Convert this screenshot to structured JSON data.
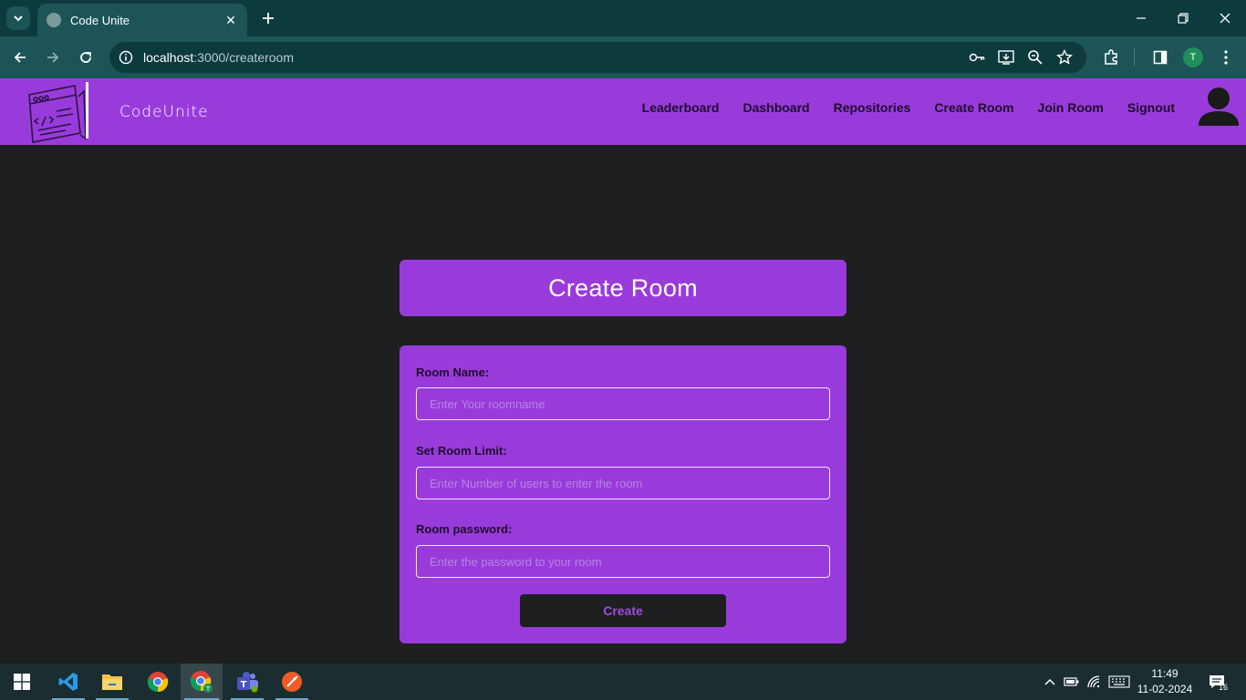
{
  "browser": {
    "tab_title": "Code Unite",
    "url_host": "localhost",
    "url_path": ":3000/createroom",
    "profile_initial": "T",
    "colors": {
      "frame": "#0c3a3d",
      "toolbar": "#1d5457"
    }
  },
  "site": {
    "logo_text": "CodeUnite",
    "nav": [
      "Leaderboard",
      "Dashboard",
      "Repositories",
      "Create Room",
      "Join Room",
      "Signout"
    ],
    "colors": {
      "brand": "#993bdb",
      "background": "#1e1f20"
    }
  },
  "form": {
    "title": "Create Room",
    "room_name": {
      "label": "Room Name:",
      "placeholder": "Enter Your roomname",
      "value": ""
    },
    "room_limit": {
      "label": "Set Room Limit:",
      "placeholder": "Enter Number of users to enter the room",
      "value": ""
    },
    "room_password": {
      "label": "Room password:",
      "placeholder": "Enter the password to your room",
      "value": ""
    },
    "submit_label": "Create"
  },
  "taskbar": {
    "apps": [
      "windows-start-icon",
      "vscode-icon",
      "file-explorer-icon",
      "chrome-icon",
      "chrome-profile-icon",
      "teams-icon",
      "postman-icon"
    ],
    "time": "11:49",
    "date": "11-02-2024",
    "notification_count": "16"
  }
}
